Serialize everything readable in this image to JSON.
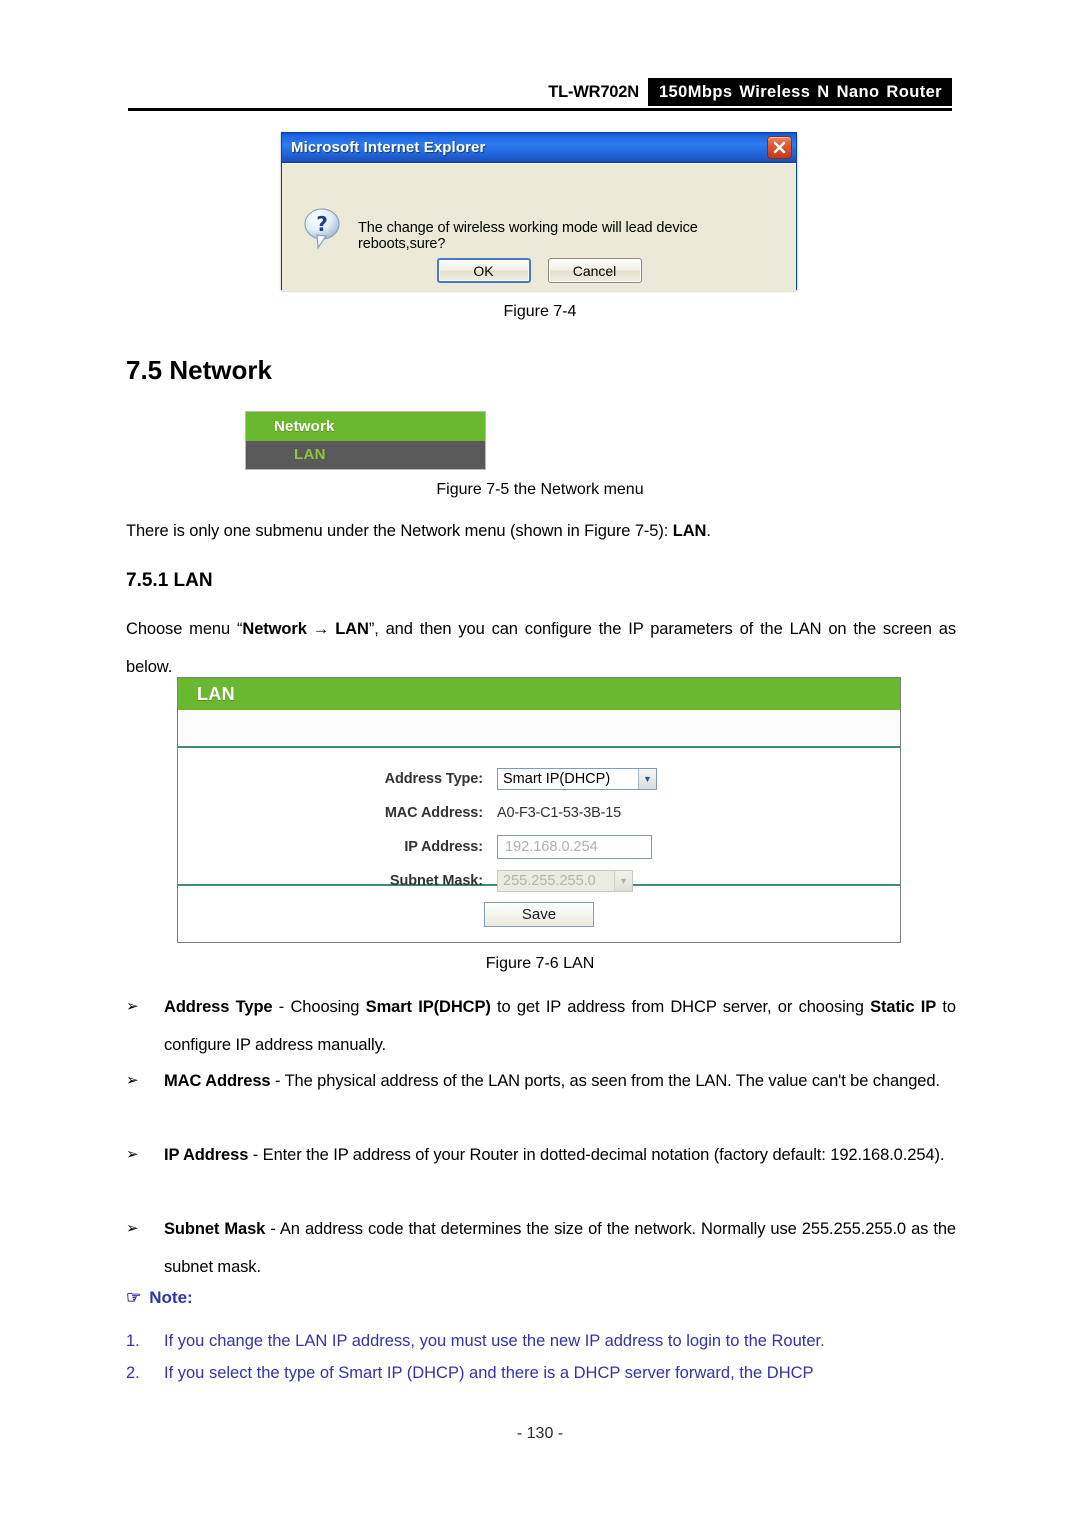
{
  "header": {
    "model": "TL-WR702N",
    "banner": "150Mbps Wireless N Nano Router"
  },
  "dialog": {
    "title": "Microsoft Internet Explorer",
    "message": "The change of wireless working mode will lead device reboots,sure?",
    "ok_label": "OK",
    "cancel_label": "Cancel",
    "close_icon": "close-icon",
    "question_icon": "question-bubble-icon"
  },
  "captions": {
    "fig_7_4": "Figure 7-4",
    "fig_7_5": "Figure 7-5   the Network menu",
    "fig_7_6": "Figure 7-6   LAN"
  },
  "headings": {
    "section_7_5": "7.5  Network",
    "section_7_5_1": "7.5.1  LAN"
  },
  "paragraphs": {
    "submenu_intro_pre": "There is only one submenu under the Network menu (shown in Figure 7-5): ",
    "submenu_intro_bold": "LAN",
    "submenu_intro_post": ".",
    "choose_menu_pre": "Choose menu “",
    "choose_menu_bold1": "Network",
    "choose_menu_arrow": "→",
    "choose_menu_bold2": "LAN",
    "choose_menu_post": "”, and then you can configure the IP parameters of the LAN on the screen as below."
  },
  "network_menu": {
    "header": "Network",
    "item": "LAN",
    "header_color": "#6ab82f",
    "item_bg": "#595959",
    "item_color": "#8ec63f"
  },
  "lan_panel": {
    "title": "LAN",
    "rows": [
      {
        "label": "Address Type:",
        "value": "Smart IP(DHCP)",
        "control": "select"
      },
      {
        "label": "MAC Address:",
        "value": "A0-F3-C1-53-3B-15",
        "control": "static"
      },
      {
        "label": "IP Address:",
        "value": "192.168.0.254",
        "control": "input"
      },
      {
        "label": "Subnet Mask:",
        "value": "255.255.255.0",
        "control": "select-disabled"
      }
    ],
    "save_label": "Save",
    "accent_color": "#6ab82f"
  },
  "bullets": [
    {
      "marker": "➢",
      "term": "Address Type",
      "sep": " - ",
      "text_pre": "Choosing ",
      "bold_mid": "Smart IP(DHCP)",
      "text_mid": " to get IP address from DHCP server, or choosing ",
      "bold_end": "Static IP",
      "text_post": " to configure IP address manually."
    },
    {
      "marker": "➢",
      "term": "MAC Address",
      "sep": " - ",
      "text_pre": "The physical address of the LAN ports, as seen from the LAN. The value can't be changed."
    },
    {
      "marker": "➢",
      "term": "IP Address",
      "sep": " - ",
      "text_pre": "Enter the IP address of your Router in dotted-decimal notation (factory default: 192.168.0.254)."
    },
    {
      "marker": "➢",
      "term": "Subnet Mask",
      "sep": " - ",
      "text_pre": "An address code that determines the size of the network. Normally use 255.255.255.0 as the subnet mask."
    }
  ],
  "note": {
    "hand_icon": "☞",
    "label": "Note:",
    "color": "#3333a8",
    "items": [
      {
        "num": "1.",
        "text": "If you change the LAN IP address, you must use the new IP address to login to the Router."
      },
      {
        "num": "2.",
        "text": "If you select the type of Smart IP (DHCP) and there is a DHCP server forward, the DHCP"
      }
    ]
  },
  "footer": {
    "page": "- 130 -"
  }
}
